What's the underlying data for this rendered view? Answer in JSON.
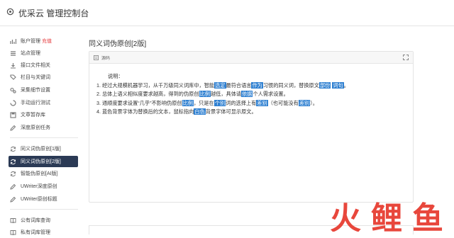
{
  "header": {
    "title": "优采云 管理控制台"
  },
  "sidebar": {
    "items": [
      {
        "label": "账户管理",
        "badge": "充值",
        "icon": "bar-chart-icon"
      },
      {
        "label": "站点管理",
        "icon": "list-icon"
      },
      {
        "label": "接口文件相关",
        "icon": "download-icon"
      },
      {
        "label": "栏目与关键词",
        "icon": "tag-icon"
      },
      {
        "label": "采集细节设置",
        "icon": "gears-icon"
      },
      {
        "label": "手动运行测试",
        "icon": "spinner-icon"
      },
      {
        "label": "文章暂存库",
        "icon": "save-icon"
      },
      {
        "label": "深度原创任务",
        "icon": "edit-icon"
      },
      {
        "label": "同义词伪原创[1版]",
        "icon": "refresh-icon"
      },
      {
        "label": "同义词伪原创[2版]",
        "icon": "refresh-icon"
      },
      {
        "label": "智能伪原创[AI版]",
        "icon": "refresh-icon"
      },
      {
        "label": "UWriter深度原创",
        "icon": "edit-icon"
      },
      {
        "label": "UWriter原创标题",
        "icon": "edit-icon"
      },
      {
        "label": "公有词库查询",
        "icon": "book-icon"
      },
      {
        "label": "私有词库管理",
        "icon": "book-icon"
      }
    ],
    "active_index": 9
  },
  "main": {
    "title": "同义词伪原创[2版]",
    "panel": {
      "header": "源码",
      "intro": "说明：",
      "lines": [
        [
          {
            "t": "1. 经过大规模机器学习，从千万级同义词库中，智能"
          },
          {
            "t": "选定",
            "hl": true
          },
          {
            "t": "最符合语言"
          },
          {
            "t": "作为",
            "hl": true
          },
          {
            "t": "习惯的同义词，替换原文"
          },
          {
            "t": "部份",
            "hl": true
          },
          {
            "t": " "
          },
          {
            "t": "词句",
            "hl": true
          },
          {
            "t": "。"
          }
        ],
        [
          {
            "t": "2. 总体上语义相似度要求越高，得到的伪原创"
          },
          {
            "t": "比例",
            "hl": true
          },
          {
            "t": "越低，具体请"
          },
          {
            "t": "依据",
            "hl": true
          },
          {
            "t": "个人需求设置。"
          }
        ],
        [
          {
            "t": "3. 通顺度要求设置“几乎”不影响伪原创"
          },
          {
            "t": "比例",
            "hl": true
          },
          {
            "t": "，只是在"
          },
          {
            "t": "个别",
            "hl": true
          },
          {
            "t": "词的选择上有"
          },
          {
            "t": "差别",
            "hl": true
          },
          {
            "t": "（也可能没有"
          },
          {
            "t": "差别",
            "hl": true
          },
          {
            "t": "）。"
          }
        ],
        [
          {
            "t": "4. 蓝色背景字体为替换后的文本，鼠标指向"
          },
          {
            "t": "白色",
            "hl": true
          },
          {
            "t": "背景字体可显示原文。"
          }
        ]
      ]
    }
  },
  "watermark": {
    "text": "火鲤鱼",
    "color": "#e8473c"
  }
}
